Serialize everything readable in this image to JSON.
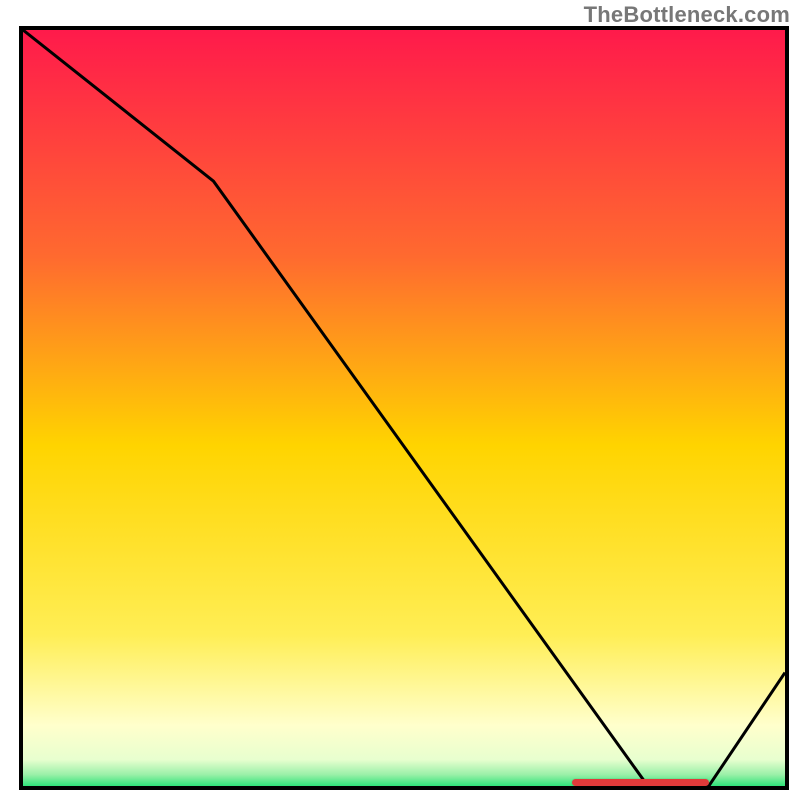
{
  "watermark": "TheBottleneck.com",
  "colors": {
    "top": "#ff1a4b",
    "mid_top": "#ff8a2a",
    "mid": "#ffd400",
    "mid_low": "#ffee55",
    "pale": "#ffffcc",
    "green": "#2fe37a",
    "marker": "#e03a3a",
    "curve": "#000000"
  },
  "gradient_stops": [
    {
      "offset": 0.0,
      "color": "#ff1a4b"
    },
    {
      "offset": 0.3,
      "color": "#ff6a2f"
    },
    {
      "offset": 0.55,
      "color": "#ffd400"
    },
    {
      "offset": 0.8,
      "color": "#ffee55"
    },
    {
      "offset": 0.92,
      "color": "#ffffcc"
    },
    {
      "offset": 0.965,
      "color": "#e8ffcf"
    },
    {
      "offset": 0.985,
      "color": "#9af0a8"
    },
    {
      "offset": 1.0,
      "color": "#2fe37a"
    }
  ],
  "chart_data": {
    "type": "line",
    "title": "",
    "xlabel": "",
    "ylabel": "",
    "xlim": [
      0,
      100
    ],
    "ylim": [
      0,
      100
    ],
    "x": [
      0,
      25,
      82,
      90,
      100
    ],
    "values": [
      100,
      80,
      0,
      0,
      15
    ],
    "marker_band": {
      "x_start": 72,
      "x_end": 90,
      "y": 0
    }
  }
}
